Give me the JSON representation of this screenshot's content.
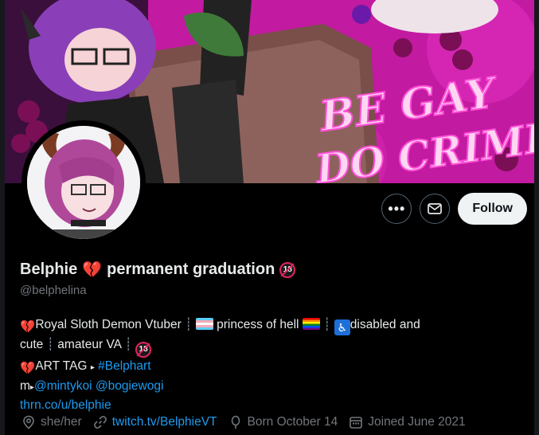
{
  "banner": {
    "text_line1": "BE GAY",
    "text_line2": "DO CRIME",
    "colors": {
      "accent": "#ff4fd8",
      "text": "#ffd6f2"
    }
  },
  "actions": {
    "more_icon": "ellipsis-icon",
    "message_icon": "envelope-icon",
    "follow_label": "Follow"
  },
  "profile": {
    "name": "Belphie",
    "name_suffix": "permanent graduation",
    "handle": "@belphelina"
  },
  "bio": {
    "line1_a": "Royal Sloth Demon Vtuber",
    "line1_b": "princess of hell",
    "line1_c": "disabled and",
    "line2_a": "cute",
    "line2_b": "amateur VA",
    "line3_label": "ART TAG",
    "line3_tag": "#Belphart",
    "line4_prefix": "m",
    "mention1": "@mintykoi",
    "mention2": "@bogiewogi",
    "link": "thrn.co/u/belphie"
  },
  "meta": {
    "location": "she/her",
    "website": "twitch.tv/BelphieVT",
    "birthday": "Born October 14",
    "joined": "Joined June 2021"
  }
}
